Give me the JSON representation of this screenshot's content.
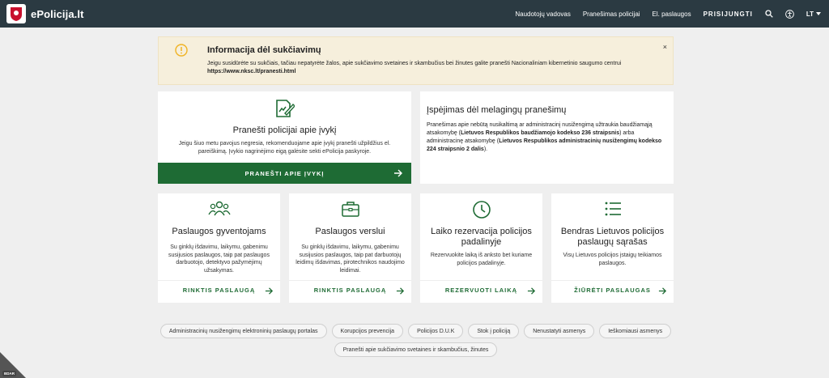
{
  "header": {
    "brand": "ePolicija.lt",
    "nav": [
      "Naudotojų vadovas",
      "Pranešimas policijai",
      "El. paslaugos"
    ],
    "login": "PRISIJUNGTI",
    "lang": "LT"
  },
  "alert": {
    "title": "Informacija dėl sukčiavimų",
    "body": "Jeigu susidūrėte su sukčiais, tačiau nepatyrėte žalos, apie sukčiavimo svetaines ir skambučius bei žinutes galite pranešti Nacionaliniam kibernetinio saugumo centrui",
    "link": "https://www.nksc.lt/pranesti.html",
    "close": "×"
  },
  "report": {
    "title": "Pranešti policijai apie įvykį",
    "desc": "Jeigu šiuo metu pavojus negresia, rekomenduojame apie įvykį pranešti užpildžius el. pareiškimą. Įvykio nagrinėjimo eigą galėsite sekti ePolicija paskyroje.",
    "button": "PRANEŠTI APIE ĮVYKĮ"
  },
  "warning": {
    "title": "Įspėjimas dėl melagingų pranešimų",
    "p1": "Pranešimas apie nebūtą nusikaltimą ar administracinį nusižengimą užtraukia baudžiamąją atsakomybę (",
    "b1": "Lietuvos Respublikos baudžiamojo kodekso 236 straipsnis",
    "p2": ") arba administracinę atsakomybę (",
    "b2": "Lietuvos Respublikos administracinių nusižengimų kodekso 224 straipsnio 2 dalis",
    "p3": ")."
  },
  "services": [
    {
      "title": "Paslaugos gyventojams",
      "desc": "Su ginklų išdavimu, laikymu, gabenimu susijusios paslaugos, taip pat paslaugos darbuotojo, detektyvo pažymėjimų užsakymas.",
      "link": "RINKTIS PASLAUGĄ"
    },
    {
      "title": "Paslaugos verslui",
      "desc": "Su ginklų išdavimu, laikymu, gabenimu susijusios paslaugos, taip pat darbuotojų leidimų išdavimas, pirotechnikos naudojimo leidimai.",
      "link": "RINKTIS PASLAUGĄ"
    },
    {
      "title": "Laiko rezervacija policijos padalinyje",
      "desc": "Rezervuokite laiką iš anksto bet kuriame policijos padalinyje.",
      "link": "REZERVUOTI LAIKĄ"
    },
    {
      "title": "Bendras Lietuvos policijos paslaugų sąrašas",
      "desc": "Visų Lietuvos policijos įstaigų teikiamos paslaugos.",
      "link": "ŽIŪRĖTI PASLAUGAS"
    }
  ],
  "tags": [
    "Administracinių nusižengimų elektroninių paslaugų portalas",
    "Korupcijos prevencija",
    "Policijos D.U.K",
    "Stok į policiją",
    "Nenustatyti asmenys",
    "Ieškomiausi asmenys",
    "Pranešti apie sukčiavimo svetaines ir skambučius, žinutes"
  ],
  "corner": "BDAR"
}
